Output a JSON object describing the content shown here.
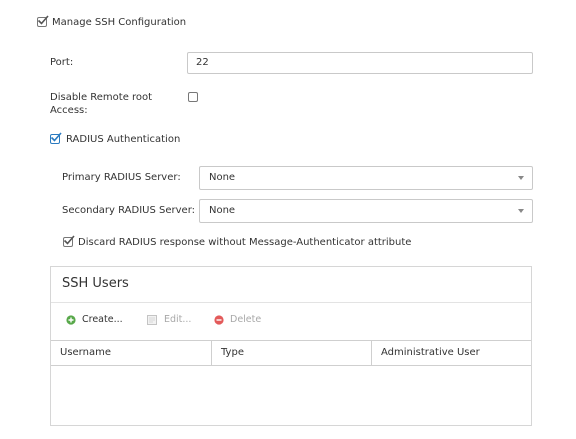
{
  "manage_ssh": {
    "label": "Manage SSH Configuration",
    "checked": true
  },
  "port": {
    "label": "Port:",
    "value": "22"
  },
  "disable_root": {
    "label_line1": "Disable Remote root",
    "label_line2": "Access:",
    "checked": false
  },
  "radius": {
    "label": "RADIUS Authentication",
    "checked": true
  },
  "primary": {
    "label": "Primary RADIUS Server:",
    "value": "None"
  },
  "secondary": {
    "label": "Secondary RADIUS Server:",
    "value": "None"
  },
  "discard": {
    "label": "Discard RADIUS response without Message-Authenticator attribute",
    "checked": true
  },
  "ssh_users": {
    "title": "SSH Users",
    "toolbar": {
      "create": "Create...",
      "edit": "Edit...",
      "delete": "Delete"
    },
    "columns": [
      "Username",
      "Type",
      "Administrative User"
    ]
  },
  "icons": [
    "check-icon",
    "plus-circle-icon",
    "edit-icon",
    "minus-circle-icon",
    "caret-down-icon"
  ],
  "colors": {
    "checkbox_blue": "#2b7bc0",
    "create_green": "#58a84a",
    "delete_red": "#e35a5a",
    "disabled_text": "#a8a8a8"
  }
}
